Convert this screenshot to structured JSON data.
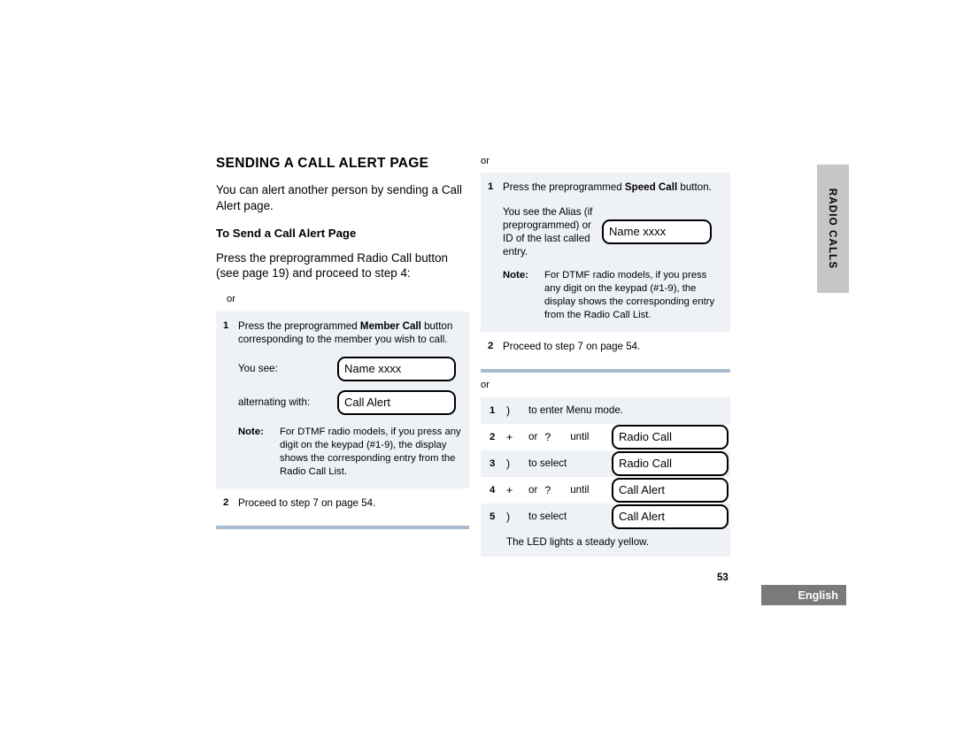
{
  "document": {
    "heading": "SENDING A CALL ALERT PAGE",
    "intro": "You can alert another person by sending a Call Alert page.",
    "subheading": "To Send a Call Alert Page",
    "lead": "Press the preprogrammed Radio Call button (see page 19) and proceed to step 4:",
    "or_label": "or"
  },
  "left_column": {
    "or_label": "or",
    "step1": {
      "number": "1",
      "text_before": "Press the preprogrammed ",
      "text_bold": "Member Call",
      "text_after": " button corresponding to the member you wish to call."
    },
    "you_see_label": "You see:",
    "you_see_display": "Name xxxx",
    "alternating_label": "alternating with:",
    "alternating_display": "Call Alert",
    "note": {
      "term": "Note:",
      "text": "For DTMF radio models, if you press any digit on the keypad (#1-9), the display shows the corresponding entry from the Radio Call List."
    },
    "step2": {
      "number": "2",
      "text": "Proceed to step 7 on page 54."
    }
  },
  "right_column_top": {
    "or_label": "or",
    "step1": {
      "number": "1",
      "text_before": "Press the preprogrammed ",
      "text_bold": "Speed Call",
      "text_after": " button."
    },
    "alias_text": "You see the Alias (if preprogrammed) or ID of the last called entry.",
    "alias_display": "Name xxxx",
    "note": {
      "term": "Note:",
      "text": "For DTMF radio models, if you press any digit on the keypad (#1-9), the display shows the corresponding entry from the Radio Call List."
    },
    "step2": {
      "number": "2",
      "text": "Proceed to step 7 on page 54."
    }
  },
  "right_column_bottom": {
    "or_label": "or",
    "rows": [
      {
        "number": "1",
        "key": ")",
        "kind": "plain",
        "text": "to enter Menu mode.",
        "display": ""
      },
      {
        "number": "2",
        "key": "+",
        "kind": "choice",
        "or_word": "or",
        "key2": "?",
        "until_word": "until",
        "display": "Radio Call"
      },
      {
        "number": "3",
        "key": ")",
        "kind": "plain",
        "text": "to select",
        "display": "Radio Call"
      },
      {
        "number": "4",
        "key": "+",
        "kind": "choice",
        "or_word": "or",
        "key2": "?",
        "until_word": "until",
        "display": "Call Alert"
      },
      {
        "number": "5",
        "key": ")",
        "kind": "plain",
        "text": "to select",
        "display": "Call Alert"
      }
    ],
    "led_text": "The LED lights a steady yellow."
  },
  "chrome": {
    "thumb_tab": "RADIO CALLS",
    "page_number": "53",
    "language": "English"
  },
  "colors": {
    "panel": "#eef1f6",
    "rule": "#a9bcce",
    "tab": "#c6c6c6",
    "language_box": "#7a7a7a"
  }
}
